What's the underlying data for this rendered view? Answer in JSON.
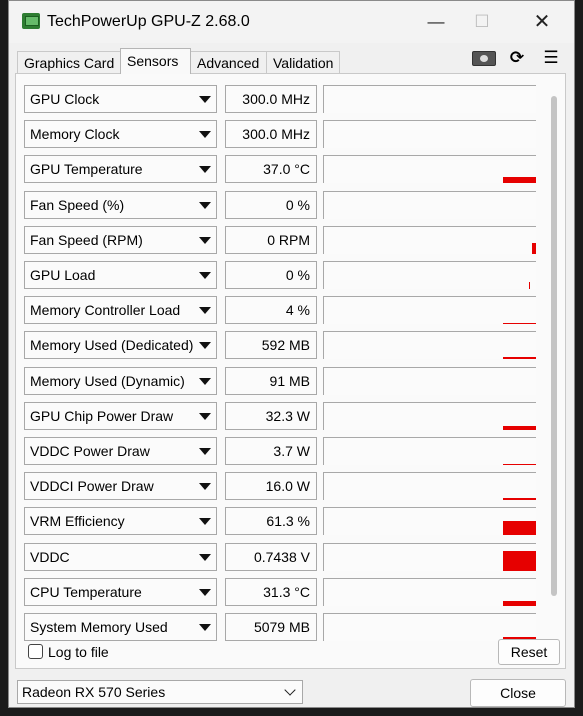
{
  "window": {
    "title": "TechPowerUp GPU-Z 2.68.0",
    "controls": {
      "minimize": "—",
      "maximize": "☐",
      "close": "✕"
    }
  },
  "tabs": [
    {
      "label": "Graphics Card",
      "active": false
    },
    {
      "label": "Sensors",
      "active": true
    },
    {
      "label": "Advanced",
      "active": false
    },
    {
      "label": "Validation",
      "active": false
    }
  ],
  "toolbar": {
    "refresh_glyph": "⟳",
    "menu_glyph": "☰"
  },
  "sensors": [
    {
      "name": "GPU Clock",
      "value": "300.0 MHz"
    },
    {
      "name": "Memory Clock",
      "value": "300.0 MHz"
    },
    {
      "name": "GPU Temperature",
      "value": "37.0 °C"
    },
    {
      "name": "Fan Speed (%)",
      "value": "0 %"
    },
    {
      "name": "Fan Speed (RPM)",
      "value": "0 RPM"
    },
    {
      "name": "GPU Load",
      "value": "0 %"
    },
    {
      "name": "Memory Controller Load",
      "value": "4 %"
    },
    {
      "name": "Memory Used (Dedicated)",
      "value": "592 MB"
    },
    {
      "name": "Memory Used (Dynamic)",
      "value": "91 MB"
    },
    {
      "name": "GPU Chip Power Draw",
      "value": "32.3 W"
    },
    {
      "name": "VDDC Power Draw",
      "value": "3.7 W"
    },
    {
      "name": "VDDCI Power Draw",
      "value": "16.0 W"
    },
    {
      "name": "VRM Efficiency",
      "value": "61.3 %"
    },
    {
      "name": "VDDC",
      "value": "0.7438 V"
    },
    {
      "name": "CPU Temperature",
      "value": "31.3 °C"
    },
    {
      "name": "System Memory Used",
      "value": "5079 MB"
    }
  ],
  "graph_color": "#e60000",
  "log_to_file": {
    "label": "Log to file",
    "checked": false
  },
  "reset_label": "Reset",
  "gpu_select": {
    "selected": "Radeon RX 570 Series"
  },
  "close_label": "Close"
}
